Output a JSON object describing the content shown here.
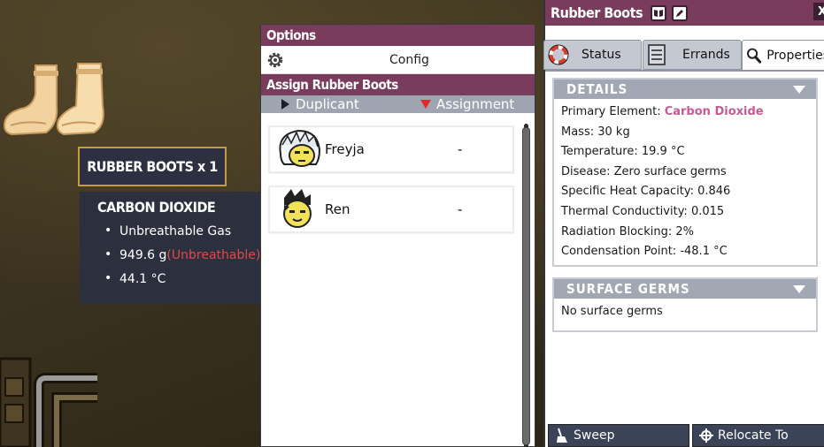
{
  "tooltip": {
    "title": "RUBBER BOOTS x 1",
    "element": "CARBON DIOXIDE",
    "items": [
      {
        "text": "Unbreathable Gas",
        "note": ""
      },
      {
        "text": "949.6 g",
        "note": "(Unbreathable)"
      },
      {
        "text": "44.1 °C",
        "note": ""
      }
    ]
  },
  "assign_panel": {
    "options_header": "Options",
    "config_label": "Config",
    "assign_header": "Assign Rubber Boots",
    "col_duplicant": "Duplicant",
    "col_assignment": "Assignment",
    "rows": [
      {
        "name": "Freyja",
        "assignment": "-"
      },
      {
        "name": "Ren",
        "assignment": "-"
      }
    ]
  },
  "details": {
    "title": "Rubber Boots",
    "close_glyph": "X",
    "tabs": [
      {
        "label": "Status",
        "icon": "lifebuoy-icon"
      },
      {
        "label": "Errands",
        "icon": "errands-list-icon"
      },
      {
        "label": "Properties",
        "icon": "magnifier-icon"
      }
    ],
    "details_header": "DETAILS",
    "primary_element_label": "Primary Element: ",
    "primary_element_value": "Carbon Dioxide",
    "lines": [
      "Mass: 30 kg",
      "Temperature: 19.9 °C",
      "Disease: Zero surface germs",
      "Specific Heat Capacity: 0.846",
      "Thermal Conductivity: 0.015",
      "Radiation Blocking: 2%",
      "Condensation Point: -48.1 °C"
    ],
    "germs_header": "SURFACE GERMS",
    "germs_text": "No surface germs",
    "sweep_label": "Sweep",
    "relocate_label": "Relocate To"
  },
  "colors": {
    "header_purple": "#7a3c5c",
    "tooltip_bg": "#2c3040",
    "tooltip_border": "#c79a3c",
    "element_pink": "#c65b93",
    "unbreathable_red": "#e04848",
    "section_grey": "#a2a8b3"
  }
}
